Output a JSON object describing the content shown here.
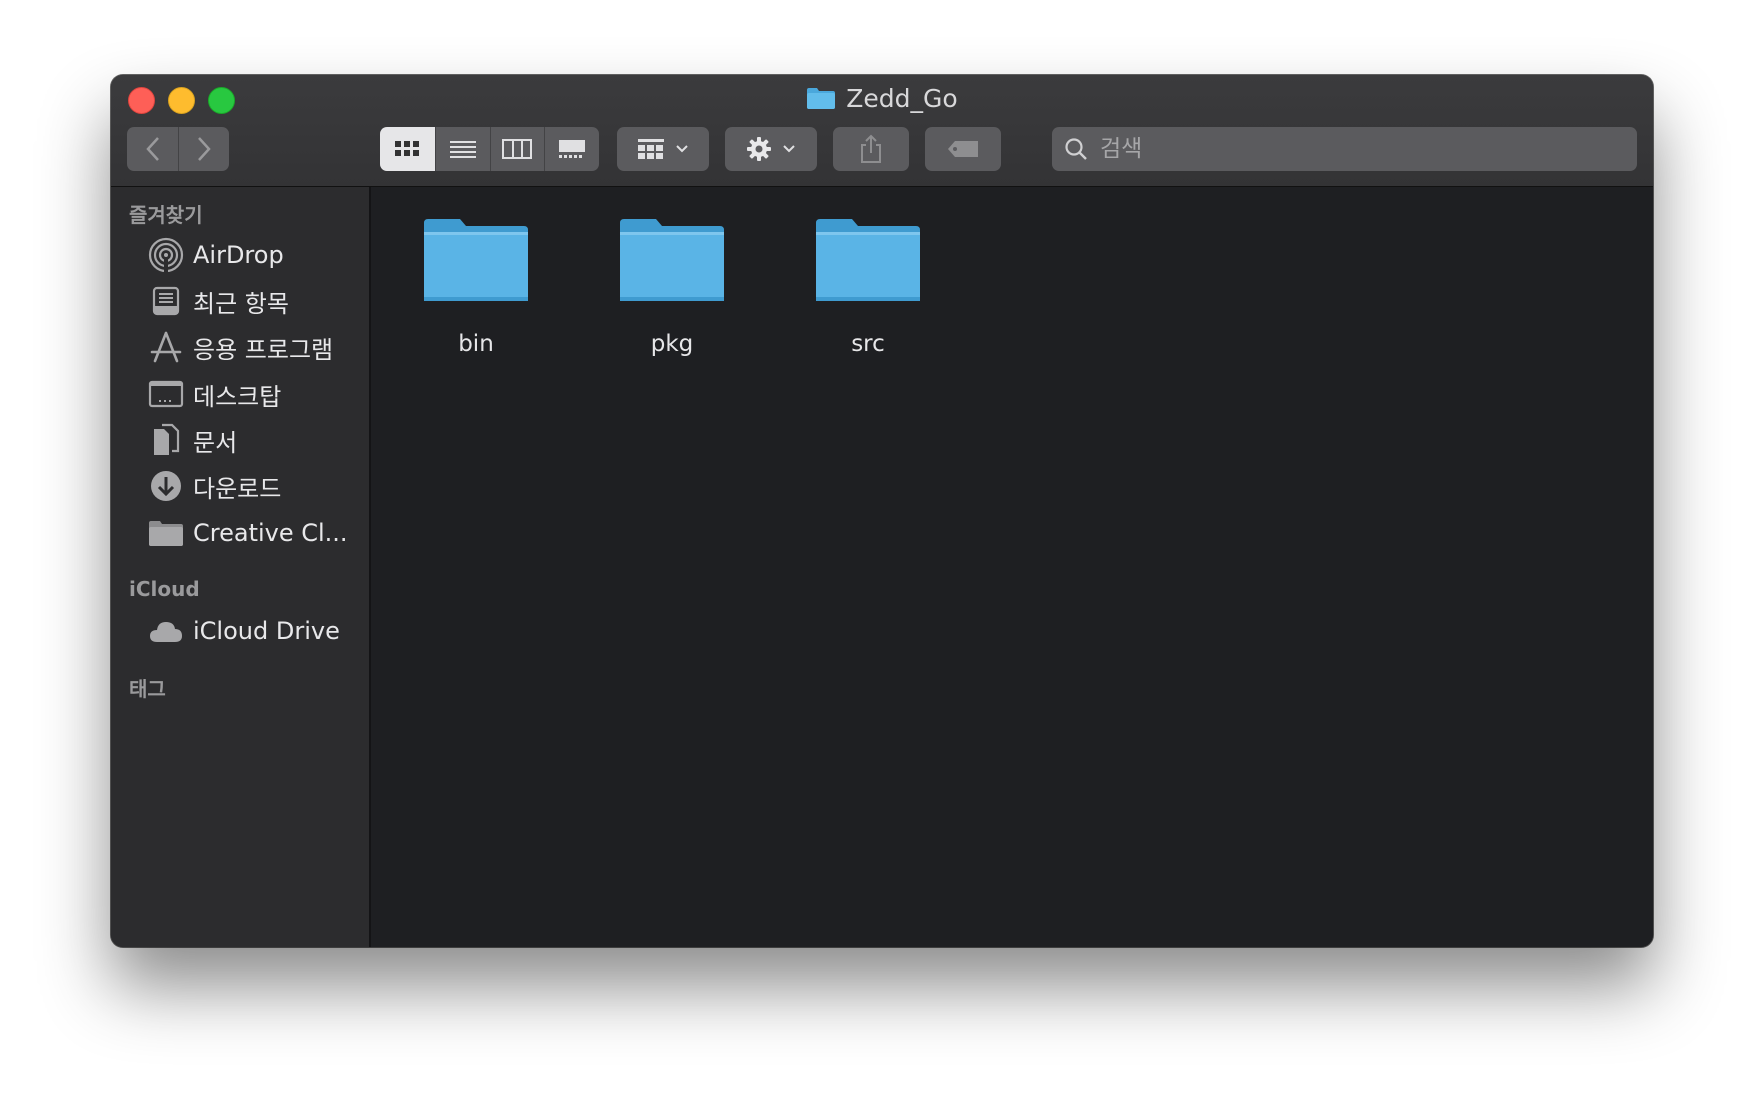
{
  "window": {
    "title": "Zedd_Go",
    "title_icon": "folder-icon"
  },
  "toolbar": {
    "nav": [
      {
        "name": "back",
        "icon": "chevron-left-icon"
      },
      {
        "name": "forward",
        "icon": "chevron-right-icon"
      }
    ],
    "views": [
      {
        "name": "icon-view",
        "icon": "grid-icon",
        "active": true
      },
      {
        "name": "list-view",
        "icon": "list-icon",
        "active": false
      },
      {
        "name": "column-view",
        "icon": "columns-icon",
        "active": false
      },
      {
        "name": "gallery-view",
        "icon": "gallery-icon",
        "active": false
      }
    ],
    "arrange_icon": "arrange-grid-icon",
    "action_icon": "gear-icon",
    "share_icon": "share-icon",
    "tags_icon": "tag-icon",
    "search": {
      "placeholder": "검색",
      "value": ""
    }
  },
  "sidebar": {
    "favorites_header": "즐겨찾기",
    "favorites": [
      {
        "label": "AirDrop",
        "icon": "airdrop-icon"
      },
      {
        "label": "최근 항목",
        "icon": "recents-icon"
      },
      {
        "label": "응용 프로그램",
        "icon": "applications-icon"
      },
      {
        "label": "데스크탑",
        "icon": "desktop-icon"
      },
      {
        "label": "문서",
        "icon": "documents-icon"
      },
      {
        "label": "다운로드",
        "icon": "downloads-icon"
      },
      {
        "label": "Creative Cl...",
        "icon": "folder-icon"
      }
    ],
    "icloud_header": "iCloud",
    "icloud": [
      {
        "label": "iCloud Drive",
        "icon": "cloud-icon"
      }
    ],
    "tags_header": "태그"
  },
  "files": [
    {
      "label": "bin",
      "icon": "folder-icon"
    },
    {
      "label": "pkg",
      "icon": "folder-icon"
    },
    {
      "label": "src",
      "icon": "folder-icon"
    }
  ],
  "colors": {
    "folder": "#5ab4e6",
    "close": "#fe5f57",
    "minimize": "#febc2e",
    "maximize": "#28c840"
  }
}
